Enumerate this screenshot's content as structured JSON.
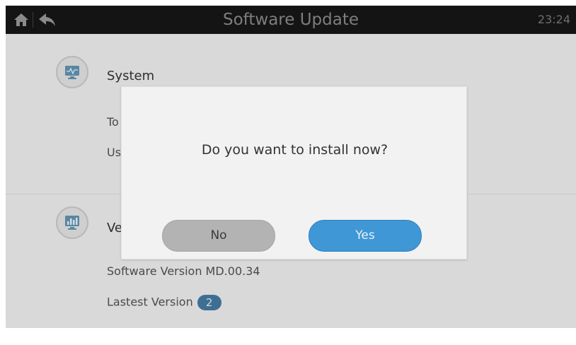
{
  "titlebar": {
    "title": "Software Update",
    "time": "23:24",
    "home_icon": "home-icon",
    "back_icon": "back-arrow-icon"
  },
  "system_section": {
    "title": "System",
    "icon": "monitor-pulse-icon",
    "row1_partial": "To",
    "row2_partial": "Us"
  },
  "version_section": {
    "title_partial": "Ve",
    "icon": "monitor-chart-icon",
    "software_version_label": "Software Version",
    "software_version_value": "MD.00.34",
    "latest_version_label": "Lastest Version",
    "latest_version_badge": "2"
  },
  "dialog": {
    "message": "Do you want to install now?",
    "no_label": "No",
    "yes_label": "Yes"
  },
  "colors": {
    "titlebar_bg": "#141414",
    "yes_button": "#3f97d6",
    "no_button": "#b3b3b3",
    "badge": "#3e6f92"
  }
}
